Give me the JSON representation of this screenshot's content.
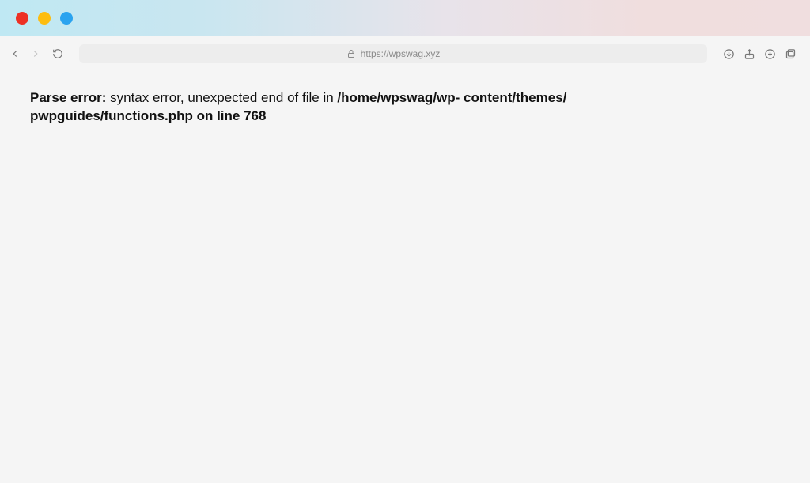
{
  "url": "https://wpswag.xyz",
  "error": {
    "label": "Parse error:",
    "message_prefix": " syntax error, unexpected end of file in ",
    "path_part1": "/home/wpswag/wp- content/themes/",
    "path_part2": "pwpguides/functions.php on line 768"
  }
}
